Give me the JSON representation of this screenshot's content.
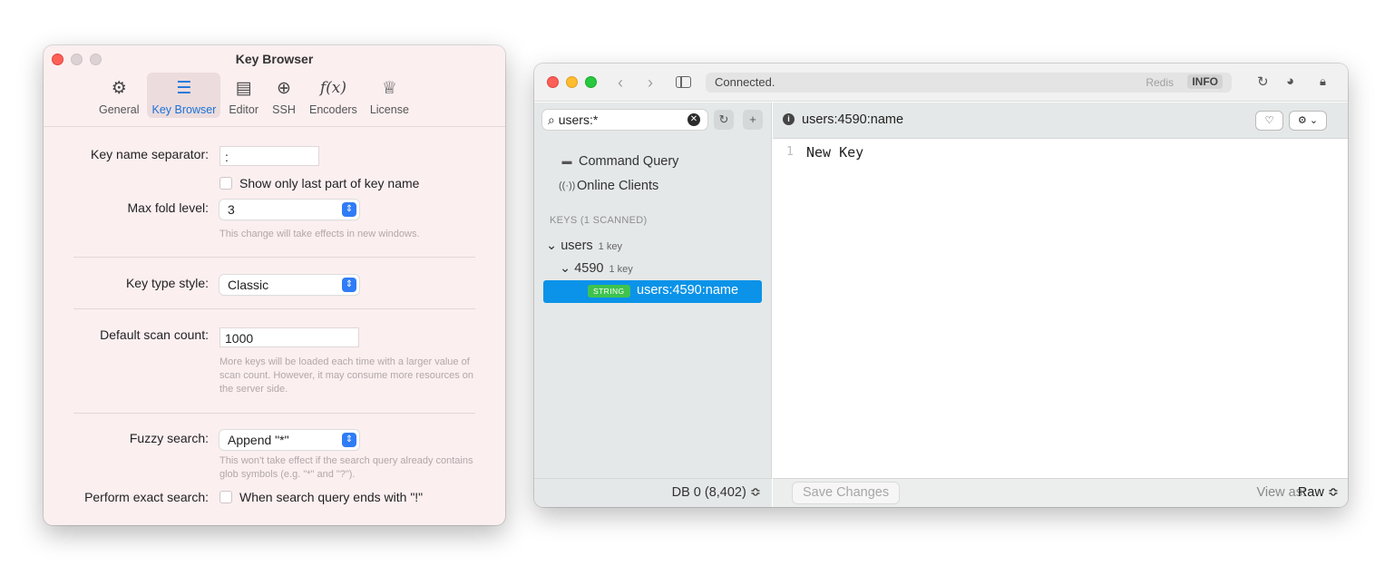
{
  "prefs": {
    "title": "Key Browser",
    "tabs": [
      {
        "label": "General",
        "icon": "gear-icon"
      },
      {
        "label": "Key Browser",
        "icon": "list-icon"
      },
      {
        "label": "Editor",
        "icon": "editor-icon"
      },
      {
        "label": "SSH",
        "icon": "globe-icon"
      },
      {
        "label": "Encoders",
        "icon": "function-icon"
      },
      {
        "label": "License",
        "icon": "badge-icon"
      }
    ],
    "key_name_separator": {
      "label": "Key name separator:",
      "value": ":"
    },
    "show_last_part": "Show only last part of key name",
    "max_fold_level": {
      "label": "Max fold level:",
      "value": "3"
    },
    "fold_hint": "This change will take effects in new windows.",
    "key_type_style": {
      "label": "Key type style:",
      "value": "Classic"
    },
    "default_scan_count": {
      "label": "Default scan count:",
      "value": "1000"
    },
    "scan_hint": "More keys will be loaded each time with a larger value of scan count. However, it may consume more resources on the server side.",
    "fuzzy_search": {
      "label": "Fuzzy search:",
      "value": "Append \"*\""
    },
    "fuzzy_hint": "This won't take effect if the search query already contains glob symbols (e.g. \"*\" and \"?\").",
    "exact_search": {
      "label": "Perform exact search:",
      "checkbox": "When search query ends with \"!\""
    }
  },
  "main": {
    "status": "Connected.",
    "redis_label": "Redis",
    "info_label": "INFO",
    "search_value": "users:*",
    "sidebar": {
      "command_query": "Command Query",
      "online_clients": "Online Clients",
      "keys_header": "KEYS (1 SCANNED)",
      "tree": [
        {
          "label": "users",
          "count": "1 key"
        },
        {
          "label": "4590",
          "count": "1 key"
        }
      ],
      "selected_key": {
        "type": "STRING",
        "name": "users:4590:name"
      },
      "db_selector": "DB 0 (8,402) ≎"
    },
    "content": {
      "key_title": "users:4590:name",
      "line_number": "1",
      "value": "New Key",
      "save_button": "Save Changes",
      "view_as_label": "View as:",
      "view_as_value": "Raw ≎"
    }
  }
}
